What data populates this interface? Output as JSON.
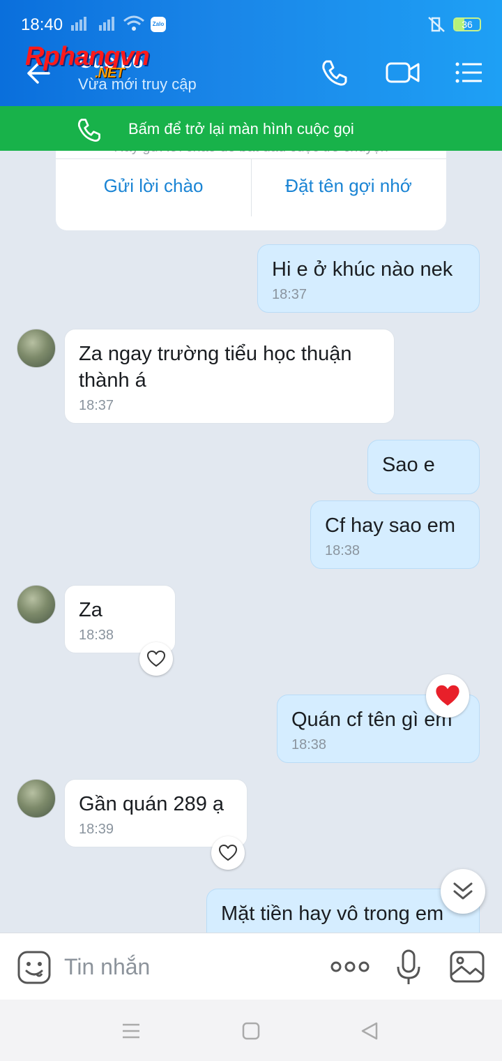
{
  "status_bar": {
    "time": "18:40",
    "app_badge": "Zalo",
    "battery": "36"
  },
  "header": {
    "title": "Cuc b6",
    "subtitle": "Vừa mới truy cập",
    "watermark": "Rphangvn",
    "watermark_suffix": ".NET"
  },
  "call_banner": {
    "text": "Bấm để trở lại màn hình cuộc gọi"
  },
  "greeting_card": {
    "hint": "Hãy gửi lời chào để bắt đầu cuộc trò chuyện",
    "send_greeting": "Gửi lời chào",
    "set_nickname": "Đặt tên gợi nhớ"
  },
  "messages": [
    {
      "from": "me",
      "text": "Hi e ở khúc nào nek",
      "time": "18:37"
    },
    {
      "from": "them",
      "text": "Za ngay trường tiểu học thuận thành á",
      "time": "18:37"
    },
    {
      "from": "me",
      "text": "Sao e",
      "time": ""
    },
    {
      "from": "me",
      "text": "Cf hay sao em",
      "time": "18:38"
    },
    {
      "from": "them",
      "text": "Za",
      "time": "18:38"
    },
    {
      "from": "me",
      "text": "Quán cf tên gì em",
      "time": "18:38"
    },
    {
      "from": "them",
      "text": "Gần quán 289 ạ",
      "time": "18:39"
    },
    {
      "from": "me",
      "text": "Mặt tiền hay vô trong em",
      "time": ""
    }
  ],
  "composer": {
    "placeholder": "Tin nhắn"
  },
  "colors": {
    "header": "#1a86e8",
    "call_banner": "#18b24a",
    "my_bubble": "#d5edff",
    "chat_bg": "#e2e8f0",
    "reaction_heart": "#e8202a"
  }
}
